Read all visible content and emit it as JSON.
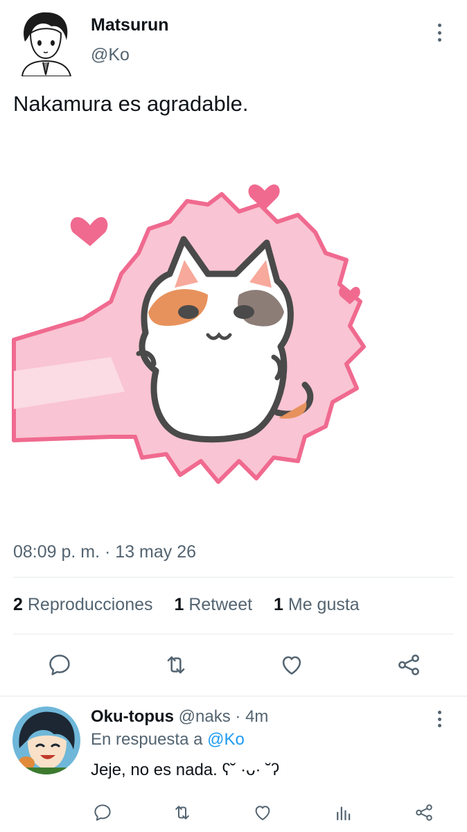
{
  "tweet": {
    "author_name": "Matsurun",
    "author_handle": "@Ko",
    "text": "Nakamura es agradable.",
    "timestamp": "08:09 p. m. · 13 may 26",
    "stats": {
      "views_count": "2",
      "views_label": "Reproducciones",
      "retweets_count": "1",
      "retweets_label": "Retweet",
      "likes_count": "1",
      "likes_label": "Me gusta"
    }
  },
  "reply": {
    "author_name": "Oku-topus",
    "author_handle": "@naks",
    "separator": "·",
    "time": "4m",
    "reply_prefix": "En respuesta a",
    "reply_mention": "@Ko",
    "text": "Jeje, no es nada. ʕ˘ ·ᴗ· ˘ʔ"
  },
  "icons": {
    "more": "more-vertical-icon",
    "reply": "reply-icon",
    "retweet": "retweet-icon",
    "like": "heart-icon",
    "share": "share-icon",
    "views": "views-icon"
  },
  "colors": {
    "text_primary": "#0f1419",
    "text_secondary": "#536471",
    "link": "#1d9bf0",
    "cat_pink": "#f06a8f"
  }
}
